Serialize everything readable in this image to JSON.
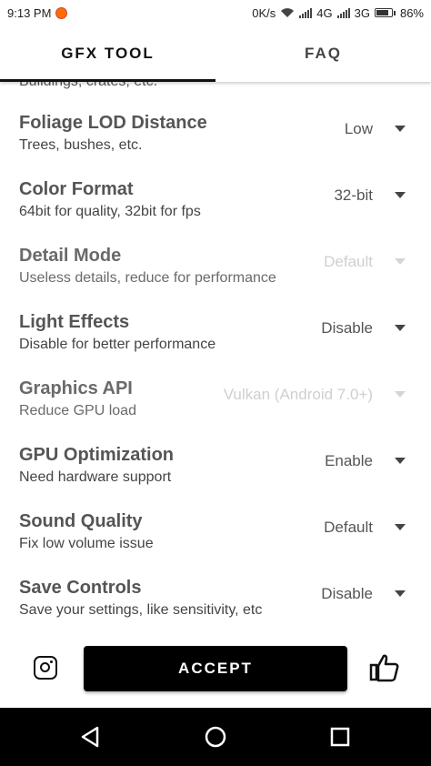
{
  "status_bar": {
    "time": "9:13 PM",
    "net_speed": "0K/s",
    "net_4g": "4G",
    "net_3g": "3G",
    "battery": "86%",
    "battery_level": 0.86
  },
  "tabs": [
    {
      "label": "GFX TOOL",
      "active": true
    },
    {
      "label": "FAQ",
      "active": false
    }
  ],
  "settings": {
    "cut_off_text": "Buildings, crates, etc.",
    "rows": [
      {
        "title": "Foliage LOD Distance",
        "desc": "Trees, bushes, etc.",
        "value": "Low",
        "enabled": true
      },
      {
        "title": "Color Format",
        "desc": "64bit for quality, 32bit for fps",
        "value": "32-bit",
        "enabled": true
      },
      {
        "title": "Detail Mode",
        "desc": "Useless details, reduce for performance",
        "value": "Default",
        "enabled": false
      },
      {
        "title": "Light Effects",
        "desc": "Disable for better performance",
        "value": "Disable",
        "enabled": true
      },
      {
        "title": "Graphics API",
        "desc": "Reduce GPU load",
        "value": "Vulkan (Android 7.0+)",
        "enabled": false
      },
      {
        "title": "GPU Optimization",
        "desc": "Need hardware support",
        "value": "Enable",
        "enabled": true
      },
      {
        "title": "Sound Quality",
        "desc": "Fix low volume issue",
        "value": "Default",
        "enabled": true
      },
      {
        "title": "Save Controls",
        "desc": "Save your settings, like sensitivity, etc",
        "value": "Disable",
        "enabled": true
      }
    ]
  },
  "bottom_bar": {
    "accept_label": "ACCEPT",
    "left_icon": "instagram-icon",
    "right_icon": "thumbs-up-icon"
  },
  "nav_bar": {
    "icons": [
      "back-icon",
      "home-icon",
      "recents-icon"
    ]
  },
  "colors": {
    "accent": "#000000",
    "disabled_text": "#cfcfcf",
    "app_icon": "#ff6d00"
  }
}
